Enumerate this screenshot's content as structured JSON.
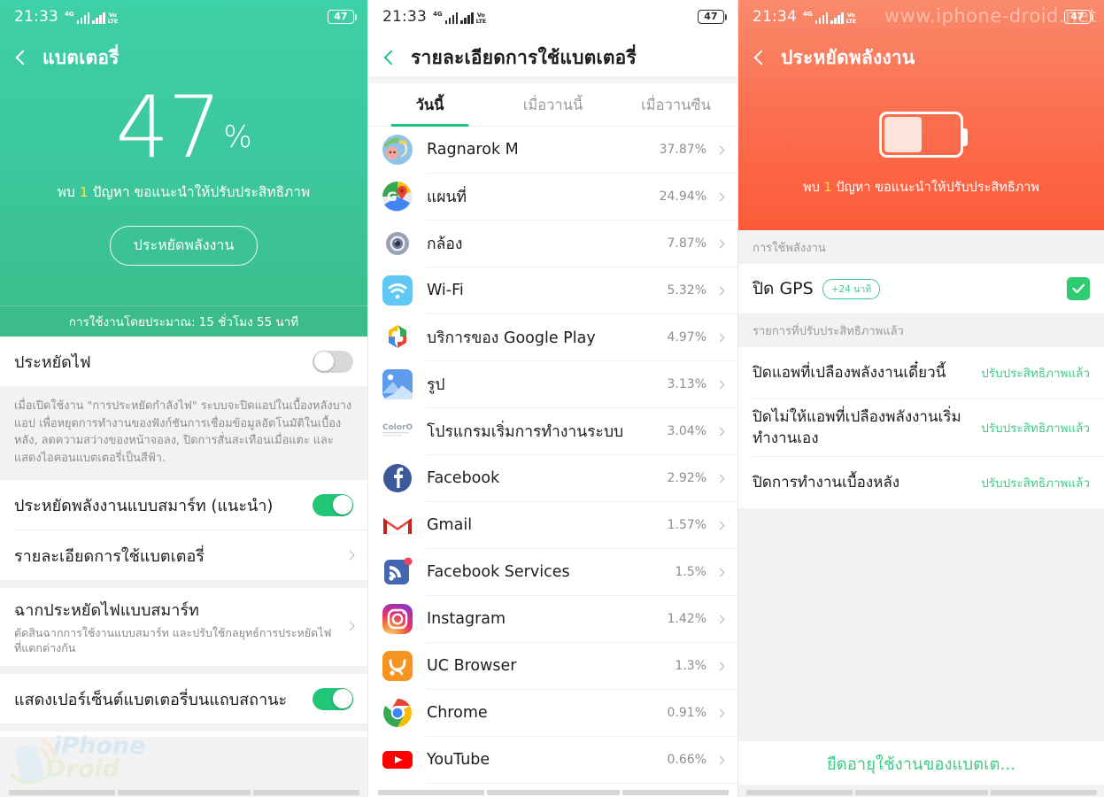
{
  "status_bars": [
    {
      "time": "21:33",
      "network": "4G",
      "volte": "Vo LTE",
      "battery": "47"
    },
    {
      "time": "21:33",
      "network": "4G",
      "volte": "Vo LTE",
      "battery": "47"
    },
    {
      "time": "21:34",
      "network": "4G",
      "volte": "Vo LTE",
      "battery": "47"
    }
  ],
  "panel1": {
    "title": "แบตเตอรี่",
    "back_icon": "chevron-left-icon",
    "battery_percent": "47",
    "percent_symbol": "%",
    "issue_prefix": "พบ",
    "issue_count": "1",
    "issue_suffix": "ปัญหา ขอแนะนำให้ปรับประสิทธิภาพ",
    "save_power_button": "ประหยัดพลังงาน",
    "estimate_text": "การใช้งานโดยประมาณ: 15 ชั่วโมง 55 นาที",
    "rows": {
      "power_save_label": "ประหยัดไฟ",
      "power_save_state": "off",
      "power_save_desc": "เมื่อเปิดใช้งาน \"การประหยัดกำลังไฟ\" ระบบจะปิดแอปในเบื้องหลังบางแอป เพื่อหยุดการทำงานของฟังก์ชันการเชื่อมข้อมูลอัตโนมัติในเบื้องหลัง, ลดความสว่างของหน้าจอลง, ปิดการสั่นสะเทือนเมื่อแตะ และแสดงไอคอนแบตเตอรี่เป็นสีฟ้า.",
      "smart_save_label": "ประหยัดพลังงานแบบสมาร์ท (แนะนำ)",
      "smart_save_state": "on",
      "battery_detail_label": "รายละเอียดการใช้แบตเตอรี่",
      "smart_scene_label": "ฉากประหยัดไฟแบบสมาร์ท",
      "smart_scene_desc": "ตัดสินฉากการใช้งานแบบสมาร์ท และปรับใช้กลยุทธ์การประหยัดไฟที่แตกต่างกัน",
      "show_percent_label": "แสดงเปอร์เซ็นต์แบตเตอรี่บนแถบสถานะ",
      "show_percent_state": "on"
    },
    "watermark": {
      "line1": "iPhone",
      "line2": "Droid"
    }
  },
  "panel2": {
    "title": "รายละเอียดการใช้แบตเตอรี่",
    "back_icon": "chevron-left-icon",
    "tabs": [
      {
        "label": "วันนี้",
        "active": true
      },
      {
        "label": "เมื่อวานนี้",
        "active": false
      },
      {
        "label": "เมื่อวานซืน",
        "active": false
      }
    ],
    "apps": [
      {
        "name": "Ragnarok M",
        "percent": "37.87%",
        "icon": "ragnarok-icon"
      },
      {
        "name": "แผนที่",
        "percent": "24.94%",
        "icon": "google-maps-icon"
      },
      {
        "name": "กล้อง",
        "percent": "7.87%",
        "icon": "camera-icon"
      },
      {
        "name": "Wi-Fi",
        "percent": "5.32%",
        "icon": "wifi-icon"
      },
      {
        "name": "บริการของ Google Play",
        "percent": "4.97%",
        "icon": "google-play-services-icon"
      },
      {
        "name": "รูป",
        "percent": "3.13%",
        "icon": "photos-icon"
      },
      {
        "name": "โปรแกรมเริ่มการทำงานระบบ",
        "percent": "3.04%",
        "icon": "coloros-icon"
      },
      {
        "name": "Facebook",
        "percent": "2.92%",
        "icon": "facebook-icon"
      },
      {
        "name": "Gmail",
        "percent": "1.57%",
        "icon": "gmail-icon"
      },
      {
        "name": "Facebook Services",
        "percent": "1.5%",
        "icon": "facebook-services-icon"
      },
      {
        "name": "Instagram",
        "percent": "1.42%",
        "icon": "instagram-icon"
      },
      {
        "name": "UC Browser",
        "percent": "1.3%",
        "icon": "uc-browser-icon"
      },
      {
        "name": "Chrome",
        "percent": "0.91%",
        "icon": "chrome-icon"
      },
      {
        "name": "YouTube",
        "percent": "0.66%",
        "icon": "youtube-icon"
      }
    ]
  },
  "panel3": {
    "title": "ประหยัดพลังงาน",
    "back_icon": "chevron-left-icon",
    "battery_fill_percent": "47",
    "issue_prefix": "พบ",
    "issue_count": "1",
    "issue_suffix": "ปัญหา ขอแนะนำให้ปรับประสิทธิภาพ",
    "section_usage": "การใช้พลังงาน",
    "gps_label": "ปิด GPS",
    "gps_time_badge": "+24 นาที",
    "gps_checked": true,
    "section_optimized": "รายการที่ปรับประสิทธิภาพแล้ว",
    "optimized": [
      {
        "label": "ปิดแอพที่เปลืองพลังงานเดี๋ยวนี้",
        "status": "ปรับประสิทธิภาพแล้ว"
      },
      {
        "label": "ปิดไม่ให้แอพที่เปลืองพลังงานเริ่มทำงานเอง",
        "status": "ปรับประสิทธิภาพแล้ว"
      },
      {
        "label": "ปิดการทำงานเบื้องหลัง",
        "status": "ปรับประสิทธิภาพแล้ว"
      }
    ],
    "bottom_cta": "ยืดอายุใช้งานของแบตเต...",
    "watermark": "www.iphone-droid.net"
  },
  "colors": {
    "green_accent": "#3DCB86",
    "green_hero_top": "#3ED0A6",
    "green_hero_bottom": "#3BBF8E",
    "orange_hero_top": "#FA8A6C",
    "orange_hero_bottom": "#FC5B39",
    "toggle_on": "#21C776",
    "issue_highlight": "#FFE14D"
  }
}
